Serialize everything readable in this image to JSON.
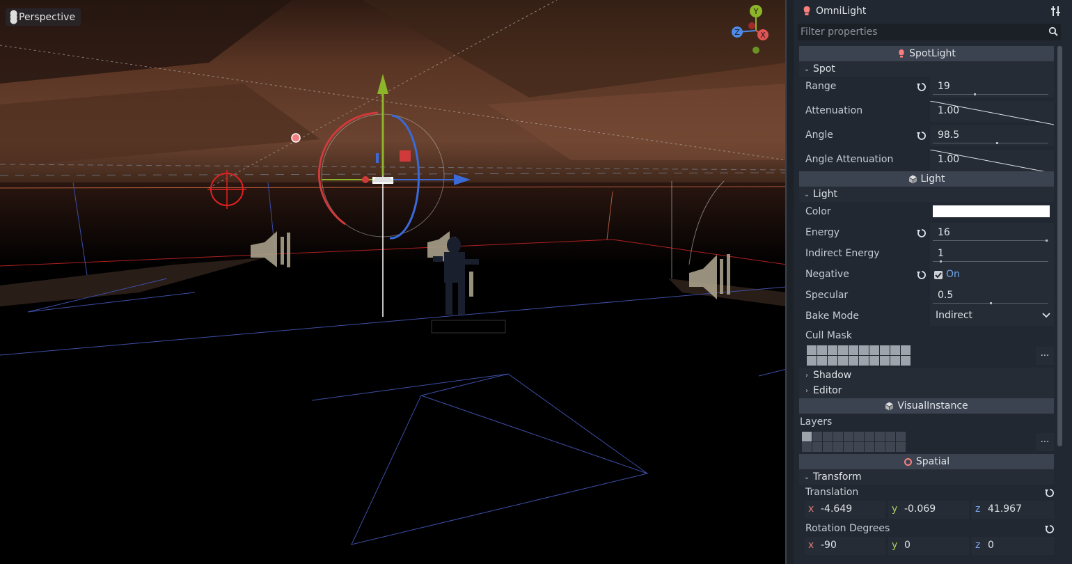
{
  "viewport": {
    "view_menu_label": "Perspective",
    "gizmo_axes": [
      "Y",
      "Z",
      "X"
    ]
  },
  "inspector": {
    "node_title": "OmniLight",
    "filter_placeholder": "Filter properties",
    "categories": {
      "spotlight": "SpotLight",
      "light": "Light",
      "visual_instance": "VisualInstance",
      "spatial": "Spatial"
    },
    "sections": {
      "spot": "Spot",
      "light": "Light",
      "shadow": "Shadow",
      "editor": "Editor",
      "transform": "Transform"
    },
    "spot": {
      "range_label": "Range",
      "range_value": "19",
      "attenuation_label": "Attenuation",
      "attenuation_value": "1.00",
      "angle_label": "Angle",
      "angle_value": "98.5",
      "angle_attenuation_label": "Angle Attenuation",
      "angle_attenuation_value": "1.00"
    },
    "light": {
      "color_label": "Color",
      "color_value": "#ffffff",
      "energy_label": "Energy",
      "energy_value": "16",
      "indirect_energy_label": "Indirect Energy",
      "indirect_energy_value": "1",
      "negative_label": "Negative",
      "negative_checked": true,
      "negative_text": "On",
      "specular_label": "Specular",
      "specular_value": "0.5",
      "bake_mode_label": "Bake Mode",
      "bake_mode_value": "Indirect",
      "cull_mask_label": "Cull Mask",
      "ellipsis": "..."
    },
    "visual_instance": {
      "layers_label": "Layers",
      "ellipsis": "..."
    },
    "transform": {
      "translation_label": "Translation",
      "translation": {
        "x": "-4.649",
        "y": "-0.069",
        "z": "41.967"
      },
      "rotation_label": "Rotation Degrees",
      "rotation": {
        "x": "-90",
        "y": "0",
        "z": "0"
      },
      "axis_x": "x",
      "axis_y": "y",
      "axis_z": "z"
    }
  },
  "colors": {
    "axis_x": "#e05454",
    "axis_y": "#8db52a",
    "axis_z": "#4e8ae8",
    "accent_on": "#6fa6ea",
    "light_icon": "#fc7f7f"
  }
}
